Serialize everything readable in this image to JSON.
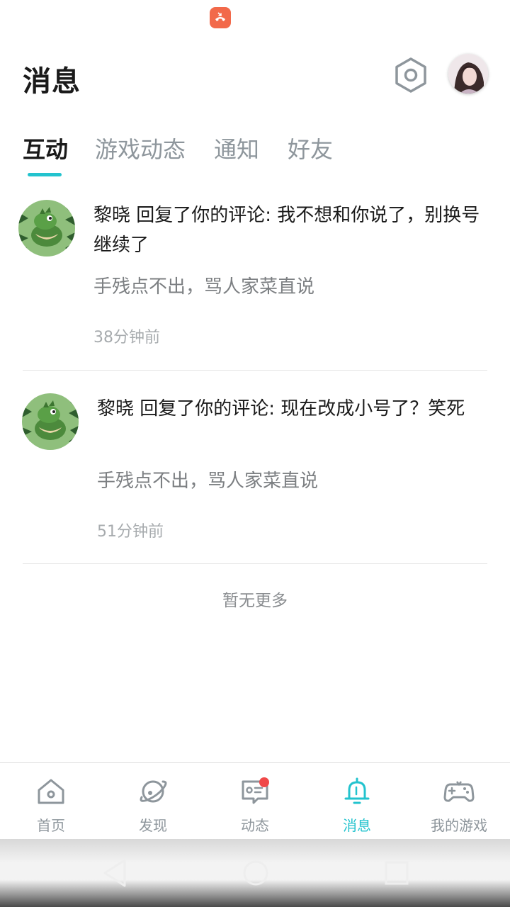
{
  "status_bar": {
    "call_icon": "missed-call-icon",
    "badge_color": "#f2694a"
  },
  "header": {
    "title": "消息",
    "settings_icon": "hexagon-gear-icon",
    "avatar": "user-avatar"
  },
  "tabs": {
    "items": [
      {
        "label": "互动",
        "active": true
      },
      {
        "label": "游戏动态",
        "active": false
      },
      {
        "label": "通知",
        "active": false
      },
      {
        "label": "好友",
        "active": false
      }
    ],
    "accent_color": "#23c3ce"
  },
  "messages": [
    {
      "title": "黎晓 回复了你的评论: 我不想和你说了，别换号继续了",
      "quote": "手残点不出，骂人家菜直说",
      "time": "38分钟前",
      "avatar": "green-dragon-avatar"
    },
    {
      "title": "黎晓 回复了你的评论: 现在改成小号了？笑死",
      "quote": "手残点不出，骂人家菜直说",
      "time": "51分钟前",
      "avatar": "green-dragon-avatar"
    }
  ],
  "footer_text": "暂无更多",
  "bottom_nav": {
    "items": [
      {
        "label": "首页",
        "icon": "home-icon",
        "active": false
      },
      {
        "label": "发现",
        "icon": "planet-icon",
        "active": false
      },
      {
        "label": "动态",
        "icon": "chat-card-icon",
        "active": false,
        "badge": true
      },
      {
        "label": "消息",
        "icon": "bell-icon",
        "active": true
      },
      {
        "label": "我的游戏",
        "icon": "gamepad-icon",
        "active": false
      }
    ],
    "badge_color": "#f04848"
  },
  "system_nav": {
    "back": "back-triangle-icon",
    "home": "home-circle-icon",
    "recents": "recents-square-icon"
  }
}
